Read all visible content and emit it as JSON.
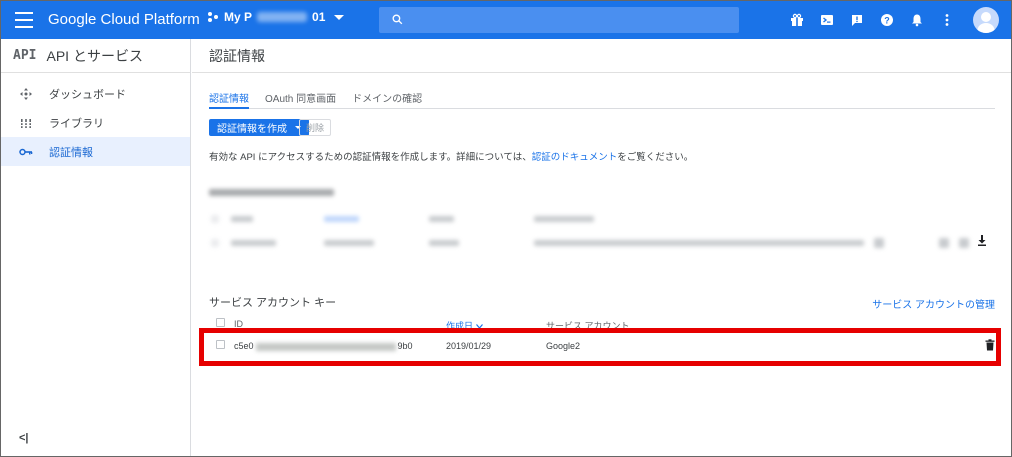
{
  "topbar": {
    "brand": "Google Cloud Platform",
    "project_prefix": "My P",
    "project_suffix": "01",
    "colors": {
      "bar": "#1a73e8"
    },
    "icons": [
      "gift-icon",
      "cloud-shell-icon",
      "feedback-icon",
      "help-icon",
      "notifications-icon",
      "more-vert-icon",
      "account-icon"
    ]
  },
  "sidebar": {
    "logo": "API",
    "title": "API とサービス",
    "items": [
      {
        "label": "ダッシュボード",
        "icon": "dashboard-icon"
      },
      {
        "label": "ライブラリ",
        "icon": "library-icon"
      },
      {
        "label": "認証情報",
        "icon": "key-icon",
        "active": true
      }
    ],
    "collapse": "<|"
  },
  "main": {
    "page_title": "認証情報",
    "tabs": [
      "認証情報",
      "OAuth 同意画面",
      "ドメインの確認"
    ],
    "create_button": "認証情報を作成",
    "delete_button": "削除",
    "info_text": "有効な API にアクセスするための認証情報を作成します。詳細については、",
    "info_link": "認証のドキュメント",
    "info_suffix": "をご覧ください。"
  },
  "service_accounts": {
    "title": "サービス アカウント キー",
    "manage_link": "サービス アカウントの管理",
    "columns": {
      "id": "ID",
      "created": "作成日",
      "account": "サービス アカウント"
    },
    "rows": [
      {
        "id_prefix": "c5e0",
        "id_suffix": "9b0",
        "created": "2019/01/29",
        "account": "Google2"
      }
    ]
  }
}
